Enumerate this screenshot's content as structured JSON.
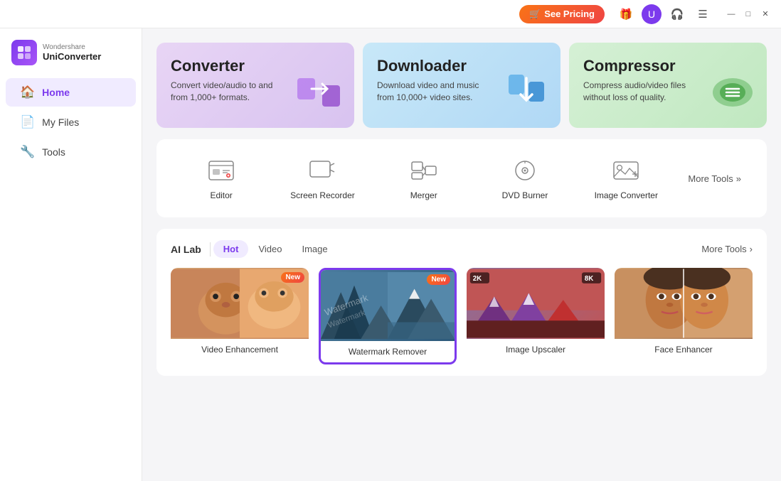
{
  "titlebar": {
    "see_pricing_label": "See Pricing",
    "gift_icon": "🎁",
    "user_initial": "U",
    "headphone_icon": "🎧",
    "menu_icon": "☰",
    "minimize_icon": "—",
    "maximize_icon": "□",
    "close_icon": "✕"
  },
  "sidebar": {
    "logo": {
      "brand": "Wondershare",
      "product": "UniConverter"
    },
    "nav_items": [
      {
        "id": "home",
        "label": "Home",
        "icon": "⌂",
        "active": true
      },
      {
        "id": "my-files",
        "label": "My Files",
        "icon": "📁",
        "active": false
      },
      {
        "id": "tools",
        "label": "Tools",
        "icon": "🔧",
        "active": false
      }
    ]
  },
  "feature_cards": [
    {
      "id": "converter",
      "title": "Converter",
      "description": "Convert video/audio to and from 1,000+ formats."
    },
    {
      "id": "downloader",
      "title": "Downloader",
      "description": "Download video and music from 10,000+ video sites."
    },
    {
      "id": "compressor",
      "title": "Compressor",
      "description": "Compress audio/video files without loss of quality."
    }
  ],
  "tools": [
    {
      "id": "editor",
      "label": "Editor"
    },
    {
      "id": "screen-recorder",
      "label": "Screen Recorder"
    },
    {
      "id": "merger",
      "label": "Merger"
    },
    {
      "id": "dvd-burner",
      "label": "DVD Burner"
    },
    {
      "id": "image-converter",
      "label": "Image Converter"
    }
  ],
  "tools_more_label": "More Tools",
  "ai_lab": {
    "label": "AI Lab",
    "tabs": [
      {
        "id": "hot",
        "label": "Hot",
        "active": true
      },
      {
        "id": "video",
        "label": "Video",
        "active": false
      },
      {
        "id": "image",
        "label": "Image",
        "active": false
      }
    ],
    "more_tools_label": "More Tools",
    "cards": [
      {
        "id": "video-enhancement",
        "label": "Video Enhancement",
        "new": true,
        "selected": false
      },
      {
        "id": "watermark-remover",
        "label": "Watermark Remover",
        "new": true,
        "selected": true
      },
      {
        "id": "image-upscaler",
        "label": "Image Upscaler",
        "new": false,
        "selected": false
      },
      {
        "id": "face-enhancer",
        "label": "Face Enhancer",
        "new": false,
        "selected": false
      }
    ]
  }
}
